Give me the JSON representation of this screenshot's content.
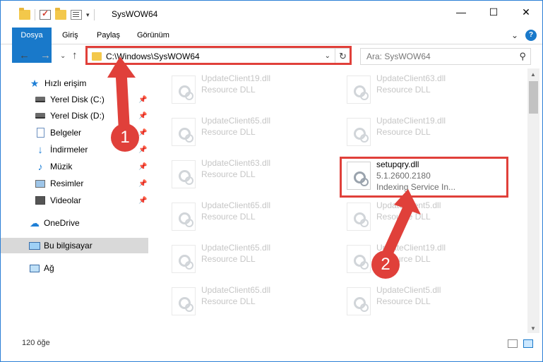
{
  "window": {
    "title": "SysWOW64"
  },
  "quick_access": {
    "icons": [
      "folder-icon",
      "properties-check-icon",
      "new-folder-icon",
      "customize-icon"
    ]
  },
  "window_buttons": {
    "minimize": "—",
    "maximize": "☐",
    "close": "✕"
  },
  "ribbon": {
    "tabs": [
      "Dosya",
      "Giriş",
      "Paylaş",
      "Görünüm"
    ],
    "help": "?"
  },
  "nav": {
    "back": "←",
    "forward": "→",
    "recent": "⌄",
    "up": "↑",
    "address": "C:\\Windows\\SysWOW64",
    "refresh": "↻",
    "search_placeholder": "Ara: SysWOW64"
  },
  "sidebar": {
    "items": [
      {
        "label": "Hızlı erişim",
        "icon": "star-icon",
        "pinned": false
      },
      {
        "label": "Yerel Disk (C:)",
        "icon": "disk-icon",
        "pinned": true
      },
      {
        "label": "Yerel Disk (D:)",
        "icon": "disk-icon",
        "pinned": true
      },
      {
        "label": "Belgeler",
        "icon": "documents-icon",
        "pinned": true
      },
      {
        "label": "İndirmeler",
        "icon": "downloads-icon",
        "pinned": true
      },
      {
        "label": "Müzik",
        "icon": "music-icon",
        "pinned": true
      },
      {
        "label": "Resimler",
        "icon": "pictures-icon",
        "pinned": true
      },
      {
        "label": "Videolar",
        "icon": "videos-icon",
        "pinned": true
      },
      {
        "label": "OneDrive",
        "icon": "cloud-icon",
        "pinned": false
      },
      {
        "label": "Bu bilgisayar",
        "icon": "computer-icon",
        "pinned": false,
        "selected": true
      },
      {
        "label": "Ağ",
        "icon": "network-icon",
        "pinned": false
      }
    ]
  },
  "files": {
    "left": [
      {
        "name": "UpdateClient19.dll",
        "type": "Resource DLL"
      },
      {
        "name": "UpdateClient65.dll",
        "type": "Resource DLL"
      },
      {
        "name": "UpdateClient63.dll",
        "type": "Resource DLL"
      },
      {
        "name": "UpdateClient65.dll",
        "type": "Resource DLL"
      },
      {
        "name": "UpdateClient65.dll",
        "type": "Resource DLL"
      },
      {
        "name": "UpdateClient65.dll",
        "type": "Resource DLL"
      }
    ],
    "right": [
      {
        "name": "UpdateClient63.dll",
        "type": "Resource DLL"
      },
      {
        "name": "UpdateClient19.dll",
        "type": "Resource DLL"
      },
      {
        "name": "setupqry.dll",
        "version": "5.1.2600.2180",
        "type": "Indexing Service In...",
        "highlighted": true
      },
      {
        "name": "UpdateClient5.dll",
        "type": "Resource DLL"
      },
      {
        "name": "UpdateClient19.dll",
        "type": "Resource DLL"
      },
      {
        "name": "UpdateClient5.dll",
        "type": "Resource DLL"
      }
    ]
  },
  "status": {
    "item_count": "120 öğe"
  },
  "annotations": {
    "step1": "1",
    "step2": "2",
    "color": "#e0403a"
  }
}
